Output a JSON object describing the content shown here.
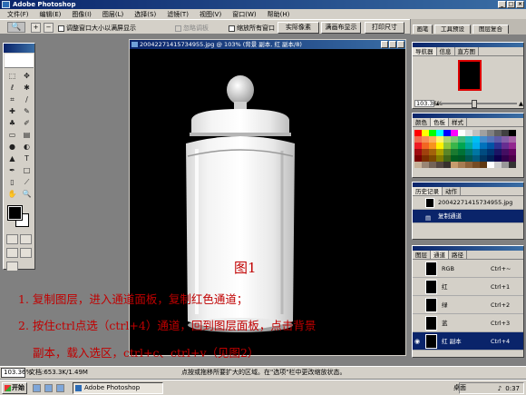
{
  "window": {
    "title": "Adobe Photoshop"
  },
  "menu": [
    "文件(F)",
    "编辑(E)",
    "图像(I)",
    "图层(L)",
    "选择(S)",
    "滤镜(T)",
    "视图(V)",
    "窗口(W)",
    "帮助(H)"
  ],
  "options": {
    "resize_label": "调整窗口大小以满屏显示",
    "ignore_palettes": "忽略调板",
    "zoom_all_windows": "缩放所有窗口",
    "actual_pixels": "实际像素",
    "fit_on_screen": "满画布显示",
    "print_size": "打印尺寸",
    "well_tabs": [
      "画笔",
      "工具预设",
      "图层复合"
    ]
  },
  "document": {
    "title": "20042271415734955.jpg @ 103% (背景 副本, 红 副本/8)",
    "figure_label": "图1"
  },
  "navigator": {
    "tabs": [
      "导航器",
      "信息",
      "直方图"
    ],
    "zoom": "103.36%"
  },
  "color_panel": {
    "tabs": [
      "颜色",
      "色板",
      "样式"
    ],
    "swatches": [
      "#ff0000",
      "#ffff00",
      "#00ff00",
      "#00ffff",
      "#0000ff",
      "#ff00ff",
      "#ffffff",
      "#e0e0e0",
      "#c0c0c0",
      "#a0a0a0",
      "#808080",
      "#606060",
      "#404040",
      "#000000",
      "#f26c4f",
      "#f68e56",
      "#fbaf5d",
      "#fff467",
      "#acd372",
      "#7cc576",
      "#3bb878",
      "#1abbb4",
      "#00bff3",
      "#438ccb",
      "#5574b9",
      "#605ca8",
      "#855fa8",
      "#a763a8",
      "#ed1c24",
      "#f26522",
      "#f7941d",
      "#fff200",
      "#8dc63f",
      "#39b54a",
      "#00a651",
      "#00a99d",
      "#00aeef",
      "#0072bc",
      "#0054a6",
      "#2e3192",
      "#662d91",
      "#92278f",
      "#9e0b0f",
      "#a0410d",
      "#a3620a",
      "#aba000",
      "#598527",
      "#1a7b30",
      "#007236",
      "#00746b",
      "#0076a3",
      "#004b80",
      "#003471",
      "#1b1464",
      "#440e62",
      "#630460",
      "#790000",
      "#7b2e00",
      "#7d4900",
      "#827b00",
      "#406618",
      "#005e20",
      "#005826",
      "#005952",
      "#005b7f",
      "#003663",
      "#002157",
      "#0d004c",
      "#32004b",
      "#4b0049",
      "#c7b299",
      "#998675",
      "#736357",
      "#534741",
      "#37302d",
      "#c69c6d",
      "#a67c52",
      "#8c6239",
      "#754c24",
      "#603913",
      "#ffffff",
      "#cccccc",
      "#999999",
      "#333333"
    ]
  },
  "history": {
    "tabs": [
      "历史记录",
      "动作"
    ],
    "rows": [
      {
        "label": "20042271415734955.jpg"
      },
      {
        "label": "复制通道"
      }
    ]
  },
  "channels": {
    "tabs": [
      "图层",
      "通道",
      "路径"
    ],
    "rows": [
      {
        "name": "RGB",
        "shortcut": "Ctrl+~"
      },
      {
        "name": "红",
        "shortcut": "Ctrl+1"
      },
      {
        "name": "绿",
        "shortcut": "Ctrl+2"
      },
      {
        "name": "蓝",
        "shortcut": "Ctrl+3"
      },
      {
        "name": "红 副本",
        "shortcut": "Ctrl+4"
      }
    ]
  },
  "instructions": {
    "line1": "1. 复制图层，进入通道面板，复制红色通道；",
    "line2": "2. 按住ctrl点选（ctrl+4）通道，回到图层面板，点击背景",
    "line3": "副本，载入选区，ctrl+c、ctrl+v（见图2）"
  },
  "status": {
    "zoom": "103.36%",
    "doc": "文档:653.3K/1.49M",
    "hint": "点按或拖移所要扩大的区域。在\"选项\"栏中更改缩放状态。"
  },
  "taskbar": {
    "start": "开始",
    "task": "Adobe Photoshop",
    "desktop": "桌面",
    "clock": "0:37"
  }
}
